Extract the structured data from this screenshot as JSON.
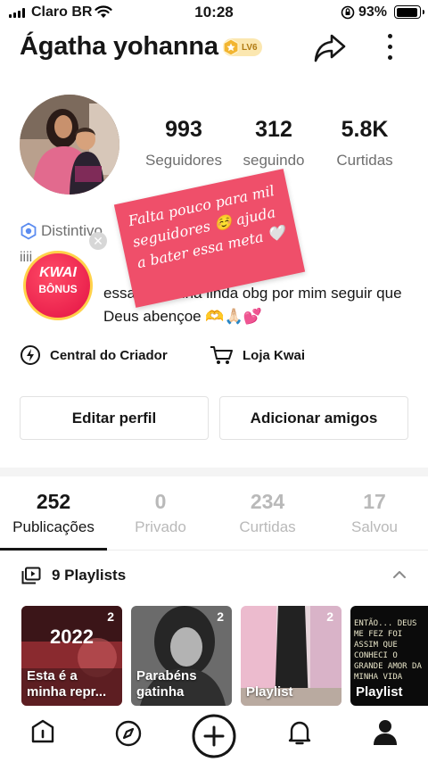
{
  "status_bar": {
    "carrier": "Claro BR",
    "time": "10:28",
    "battery": "93%"
  },
  "profile": {
    "name": "Ágatha yohanna",
    "level": "LV6",
    "stats": [
      {
        "value": "993",
        "label": "Seguidores"
      },
      {
        "value": "312",
        "label": "seguindo"
      },
      {
        "value": "5.8K",
        "label": "Curtidas"
      }
    ],
    "badge_label": "Distintivo",
    "bio_line1": "iiii ·",
    "bio_line2": "essa para filha linda obg por mim seguir que Deus abençoe 🫶🙏🏻💕"
  },
  "overlay_note": "Falta pouco para mil seguidores ☺️ ajuda a bater essa meta 🤍",
  "kwai_bonus": {
    "title": "KWAI",
    "subtitle": "BÔNUS"
  },
  "creator_links": [
    {
      "label": "Central do Criador",
      "icon": "lightning-icon"
    },
    {
      "label": "Loja Kwai",
      "icon": "cart-icon"
    }
  ],
  "buttons": {
    "edit_profile": "Editar perfil",
    "add_friends": "Adicionar amigos"
  },
  "tabs": [
    {
      "count": "252",
      "label": "Publicações",
      "active": true
    },
    {
      "count": "0",
      "label": "Privado",
      "active": false
    },
    {
      "count": "234",
      "label": "Curtidas",
      "active": false
    },
    {
      "count": "17",
      "label": "Salvou",
      "active": false
    }
  ],
  "playlists": {
    "header": "9 Playlists",
    "cards": [
      {
        "count": "2",
        "title": "Esta é a minha repr...",
        "overlay": "2022"
      },
      {
        "count": "2",
        "title": "Parabéns gatinha"
      },
      {
        "count": "2",
        "title": "Playlist"
      },
      {
        "count": "",
        "title": "Playlist",
        "overlay": "ENTÃO... DEUS ME FEZ FOI ASSIM QUE CONHECI O GRANDE AMOR DA MINHA VIDA"
      }
    ]
  },
  "bottom_nav": [
    "home-icon",
    "discover-icon",
    "create-icon",
    "notifications-icon",
    "profile-icon"
  ]
}
